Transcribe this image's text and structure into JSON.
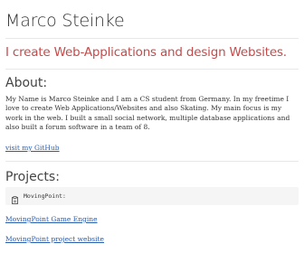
{
  "header": {
    "name": "Marco Steinke",
    "tagline": "I create Web-Applications and design Websites."
  },
  "about": {
    "heading": "About:",
    "text": "My Name is Marco Steinke and I am a CS student from Germany. In my freetime I love to create Web Applications/Websites and also Skating. My main focus is my work in the web. I built a small social network, multiple database applications and also built a forum software in a team of 8.",
    "github_link": "visit my GitHub"
  },
  "projects": {
    "heading": "Projects:",
    "code_label": "MovingPoint:",
    "links": [
      "MovingPoint Game Engine",
      "MovingPoint project website"
    ]
  },
  "colors": {
    "tagline": "#c44b4b",
    "link": "#2a5db0",
    "code_background": "#f5f5f5"
  },
  "icons": {
    "code_box": "clipboard-icon"
  }
}
